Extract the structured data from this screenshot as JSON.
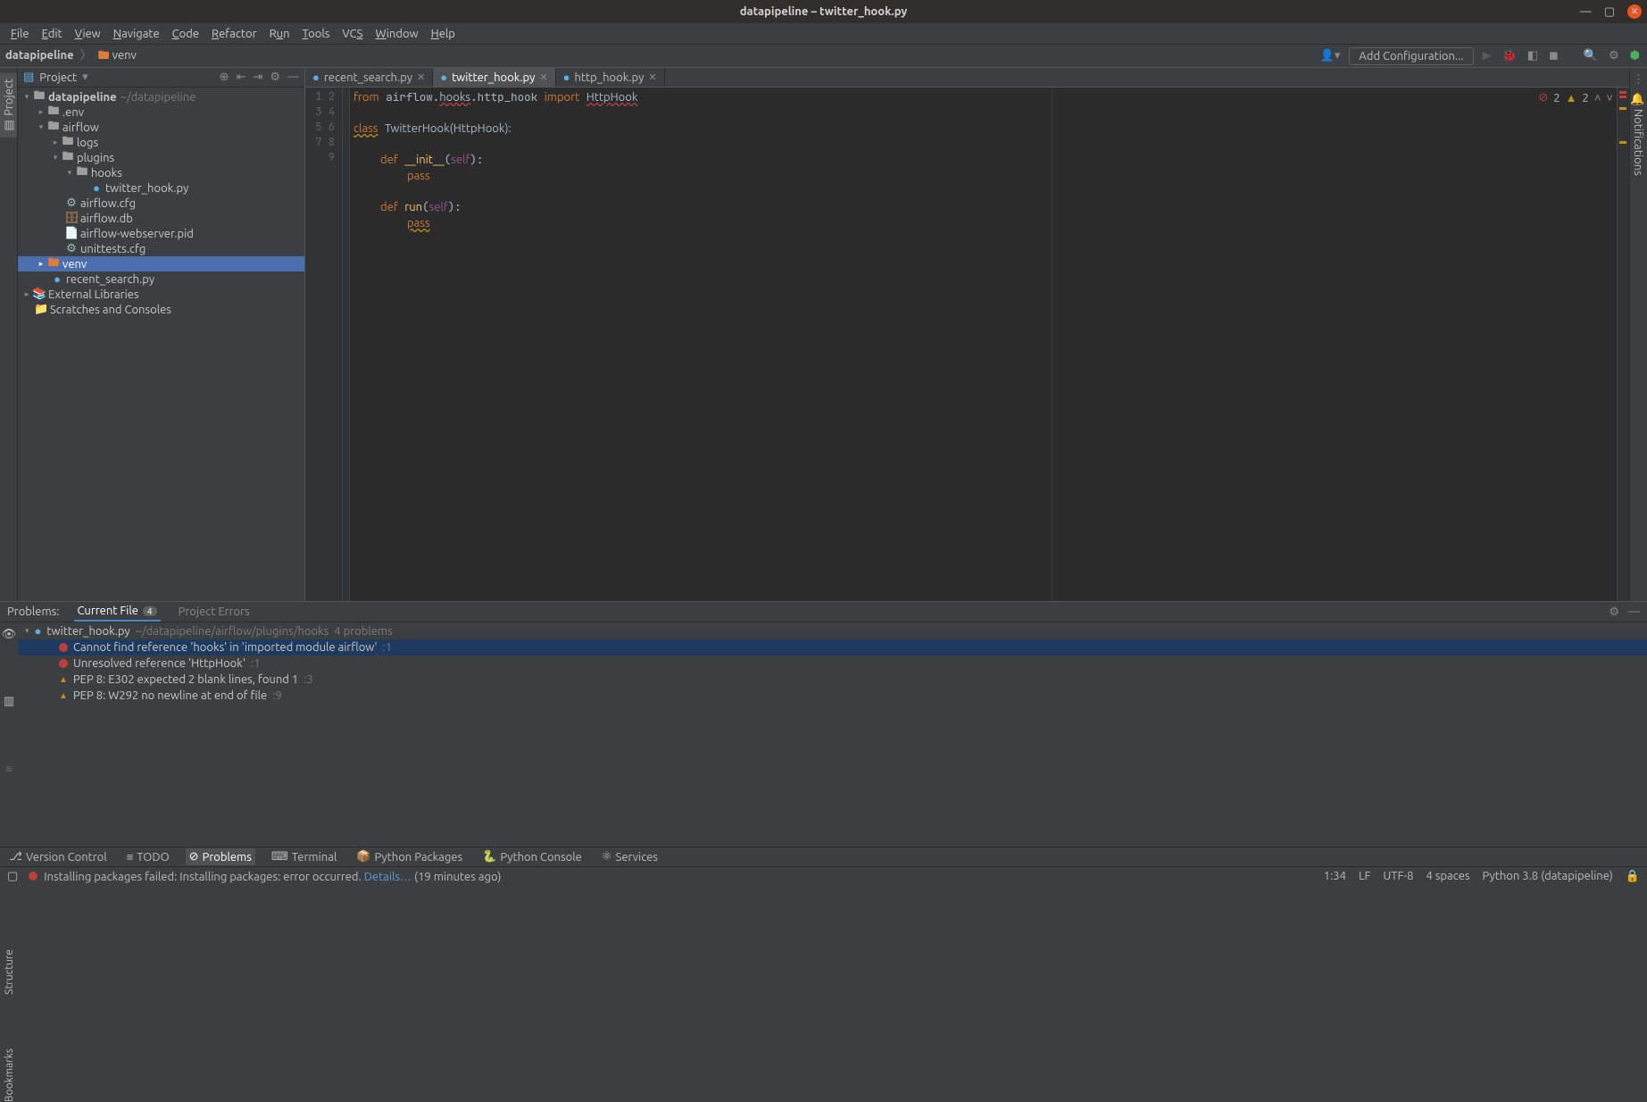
{
  "window": {
    "title": "datapipeline – twitter_hook.py"
  },
  "menu": [
    "File",
    "Edit",
    "View",
    "Navigate",
    "Code",
    "Refactor",
    "Run",
    "Tools",
    "VCS",
    "Window",
    "Help"
  ],
  "breadcrumb": {
    "project": "datapipeline",
    "item": "venv"
  },
  "toolbar": {
    "add_config": "Add Configuration..."
  },
  "sidebar": {
    "title": "Project",
    "root": {
      "name": "datapipeline",
      "path": "~/datapipeline"
    },
    "env": ".env",
    "airflow": "airflow",
    "logs": "logs",
    "plugins": "plugins",
    "hooks": "hooks",
    "twitter_hook": "twitter_hook.py",
    "airflow_cfg": "airflow.cfg",
    "airflow_db": "airflow.db",
    "webserver_pid": "airflow-webserver.pid",
    "unittests": "unittests.cfg",
    "venv": "venv",
    "recent_search": "recent_search.py",
    "ext_libs": "External Libraries",
    "scratches": "Scratches and Consoles"
  },
  "tabs": [
    {
      "label": "recent_search.py",
      "active": false
    },
    {
      "label": "twitter_hook.py",
      "active": true
    },
    {
      "label": "http_hook.py",
      "active": false
    }
  ],
  "code_lines": [
    "from airflow.hooks.http_hook import HttpHook",
    "",
    "class TwitterHook(HttpHook):",
    "",
    "    def __init__(self):",
    "        pass",
    "",
    "    def run(self):",
    "        pass"
  ],
  "inspection": {
    "errors": "2",
    "warnings": "2"
  },
  "problems": {
    "title": "Problems:",
    "tab_current": "Current File",
    "tab_current_count": "4",
    "tab_project": "Project Errors",
    "file": {
      "name": "twitter_hook.py",
      "path": "~/datapipeline/airflow/plugins/hooks",
      "count": "4 problems"
    },
    "items": [
      {
        "sev": "error",
        "text": "Cannot find reference 'hooks' in 'imported module airflow'",
        "loc": ":1",
        "selected": true
      },
      {
        "sev": "error",
        "text": "Unresolved reference 'HttpHook'",
        "loc": ":1",
        "selected": false
      },
      {
        "sev": "warn",
        "text": "PEP 8: E302 expected 2 blank lines, found 1",
        "loc": ":3",
        "selected": false
      },
      {
        "sev": "warn",
        "text": "PEP 8: W292 no newline at end of file",
        "loc": ":9",
        "selected": false
      }
    ]
  },
  "toolwindows": [
    "Version Control",
    "TODO",
    "Problems",
    "Terminal",
    "Python Packages",
    "Python Console",
    "Services"
  ],
  "status": {
    "msg_pre": "Installing packages failed: Installing packages: error occurred. ",
    "msg_link": "Details…",
    "msg_post": " (19 minutes ago)",
    "pos": "1:34",
    "lf": "LF",
    "enc": "UTF-8",
    "indent": "4 spaces",
    "interp": "Python 3.8 (datapipeline)"
  },
  "left_tabs": {
    "project": "Project"
  },
  "left_extra": {
    "structure": "Structure",
    "bookmarks": "Bookmarks"
  },
  "right_tabs": {
    "notifications": "Notifications"
  }
}
